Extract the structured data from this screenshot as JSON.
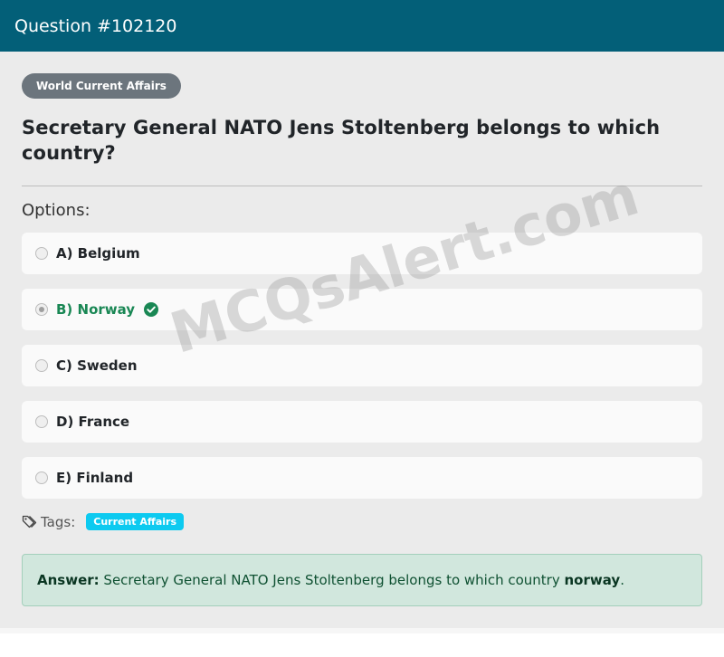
{
  "header": {
    "title": "Question #102120"
  },
  "category": "World Current Affairs",
  "question": "Secretary General NATO Jens Stoltenberg belongs to which country?",
  "options_label": "Options:",
  "options": [
    {
      "label": "A) Belgium",
      "selected": false,
      "correct": false
    },
    {
      "label": "B) Norway",
      "selected": true,
      "correct": true
    },
    {
      "label": "C) Sweden",
      "selected": false,
      "correct": false
    },
    {
      "label": "D) France",
      "selected": false,
      "correct": false
    },
    {
      "label": "E) Finland",
      "selected": false,
      "correct": false
    }
  ],
  "tags": {
    "label": "Tags:",
    "items": [
      "Current Affairs"
    ]
  },
  "answer": {
    "prefix": "Answer:",
    "text": " Secretary General NATO Jens Stoltenberg belongs to which country ",
    "value": "norway",
    "suffix": "."
  },
  "watermark": "MCQsAlert.com",
  "colors": {
    "header_bg": "#035f78",
    "correct": "#198754",
    "tag_pill": "#0dcaf0",
    "answer_bg": "#d1e7dd"
  }
}
